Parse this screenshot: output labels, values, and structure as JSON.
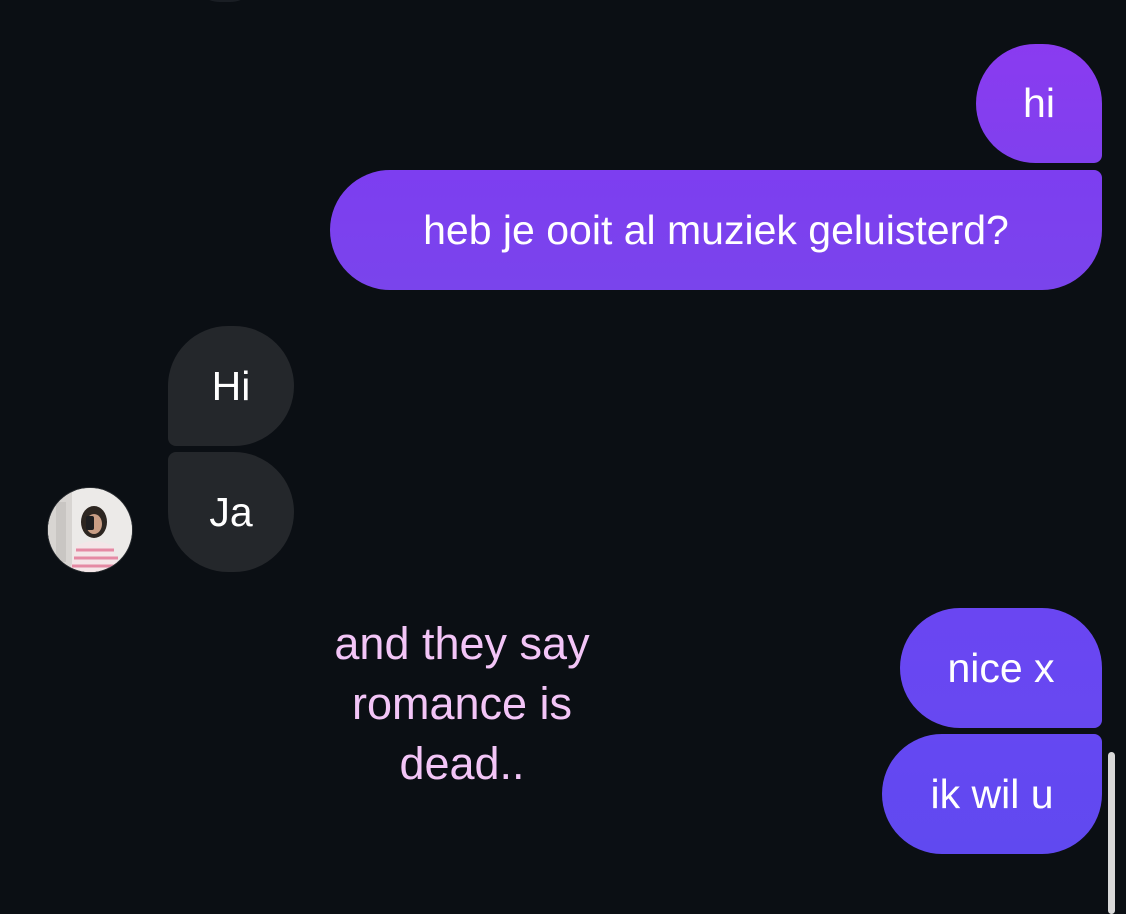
{
  "messages": [
    {
      "id": "sent-1",
      "direction": "sent",
      "text": "hi"
    },
    {
      "id": "sent-2",
      "direction": "sent",
      "text": "heb je ooit al muziek geluisterd?"
    },
    {
      "id": "recv-1",
      "direction": "received",
      "text": "Hi"
    },
    {
      "id": "recv-2",
      "direction": "received",
      "text": "Ja"
    },
    {
      "id": "sent-3",
      "direction": "sent",
      "text": "nice x"
    },
    {
      "id": "sent-4",
      "direction": "sent",
      "text": "ik wil u"
    }
  ],
  "overlay_caption": "and they say\nromance is\ndead..",
  "colors": {
    "background": "#0b0f14",
    "sent_bubble": "#7a3cf0",
    "received_bubble": "#24272b",
    "caption_text": "#f3c5f7",
    "scrollbar": "#d9d9d9"
  },
  "icons": {
    "contact_avatar": "profile-photo-icon"
  }
}
